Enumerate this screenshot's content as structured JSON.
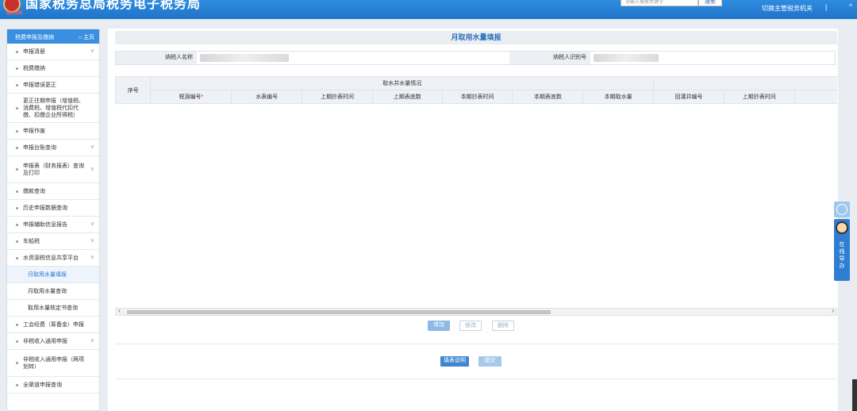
{
  "header": {
    "site_title": "国家税务总局税务电子税务局",
    "logo_stamp": "税务发票",
    "search_placeholder": "请输入搜索关键字",
    "search_button": "搜索",
    "switch_org": "切换主管税务机关",
    "separator": "|",
    "collapse": "^"
  },
  "sidebar": {
    "title": "税费申报及缴纳",
    "home": "主页",
    "items": [
      {
        "label": "申报清册",
        "chevron": true
      },
      {
        "label": "税费缴纳",
        "chevron": false
      },
      {
        "label": "申报错误更正",
        "chevron": false
      },
      {
        "label": "更正往期申报（增值税、消费税、增值税代扣代缴、扣缴企业所得税）",
        "chevron": false
      },
      {
        "label": "申报作废",
        "chevron": false
      },
      {
        "label": "申报台账查询",
        "chevron": true
      },
      {
        "label": "申报表（财务报表）查询及打印",
        "chevron": true
      },
      {
        "label": "缴款查询",
        "chevron": false
      },
      {
        "label": "历史申报数据查询",
        "chevron": false
      },
      {
        "label": "申报辅助信息报告",
        "chevron": true
      },
      {
        "label": "车船税",
        "chevron": true
      },
      {
        "label": "水资源税信息共享平台",
        "chevron": true
      },
      {
        "label": "工会经费（筹备金）申报",
        "chevron": false
      },
      {
        "label": "非税收入通用申报",
        "chevron": true
      },
      {
        "label": "非税收入通用申报（两项划转）",
        "chevron": false
      },
      {
        "label": "全渠道申报查询",
        "chevron": false
      }
    ],
    "subitems": [
      {
        "label": "月取用水量填报",
        "active": true
      },
      {
        "label": "月取用水量查询",
        "active": false
      },
      {
        "label": "取用水量核定书查询",
        "active": false
      }
    ]
  },
  "form": {
    "title": "月取用水量填报",
    "taxpayer_name_label": "纳税人名称",
    "taxpayer_id_label": "纳税人识别号"
  },
  "table": {
    "col_seq": "序号",
    "group_main": "取水井水量情况",
    "col_tax_source": "税源编号",
    "required_mark": "*",
    "subcolumns": [
      "水表编号",
      "上期抄表时间",
      "上期表底数",
      "本期抄表时间",
      "本期表底数",
      "本期取水量",
      "回灌井编号",
      "上期抄表时间",
      "上期表底数"
    ]
  },
  "scroll": {
    "left": "‹",
    "right": "›"
  },
  "buttons": {
    "add": "增加",
    "edit": "修改",
    "delete": "删除",
    "instructions": "填表说明",
    "submit": "提交"
  },
  "float_widget": {
    "text": "在线导办"
  }
}
